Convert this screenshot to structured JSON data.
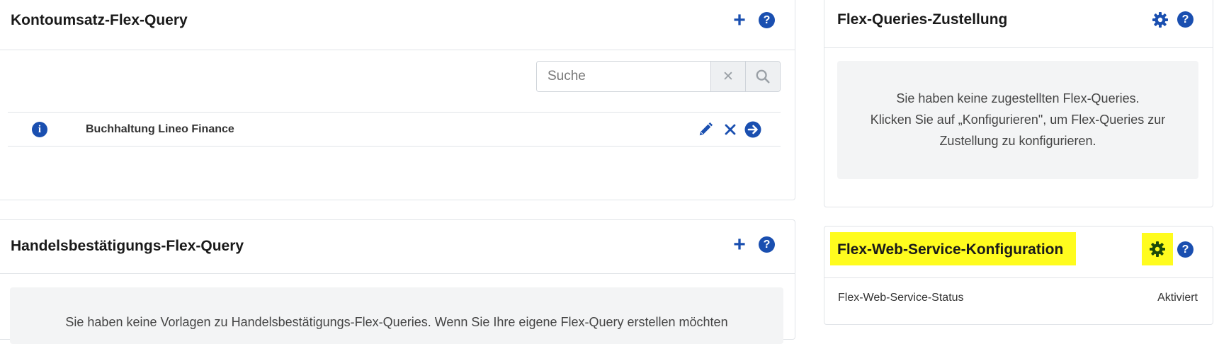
{
  "kontoumsatz": {
    "title": "Kontoumsatz-Flex-Query",
    "search_placeholder": "Suche",
    "clear_symbol": "✕",
    "items": [
      {
        "label": "Buchhaltung Lineo Finance"
      }
    ]
  },
  "handels": {
    "title": "Handelsbestätigungs-Flex-Query",
    "empty_text": "Sie haben keine Vorlagen zu Handelsbestätigungs-Flex-Queries. Wenn Sie Ihre eigene Flex-Query erstellen möchten"
  },
  "zustellung": {
    "title": "Flex-Queries-Zustellung",
    "empty_line1": "Sie haben keine zugestellten Flex-Queries.",
    "empty_line2": "Klicken Sie auf „Konfigurieren\", um Flex-Queries zur",
    "empty_line3": "Zustellung zu konfigurieren."
  },
  "webservice": {
    "title": "Flex-Web-Service-Konfiguration",
    "status_label": "Flex-Web-Service-Status",
    "status_value": "Aktiviert"
  },
  "icons": {
    "help_glyph": "?",
    "info_glyph": "i",
    "plus_glyph": "+"
  },
  "colors": {
    "accent": "#1a4fb0",
    "highlight": "#fffc1e",
    "gear_highlighted": "#1c4a0a"
  }
}
